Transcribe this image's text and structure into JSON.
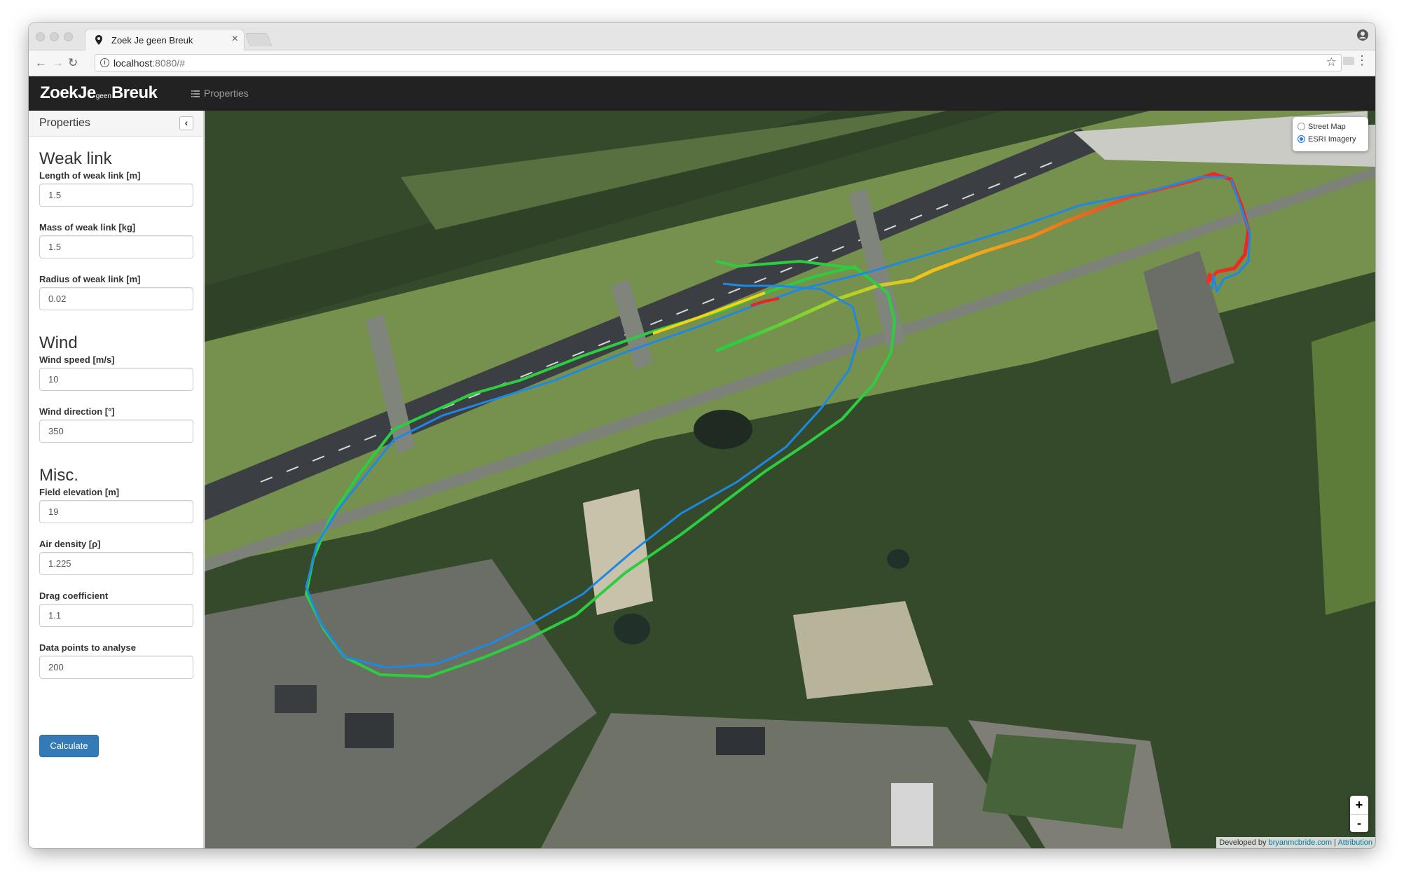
{
  "browser": {
    "tab_title": "Zoek Je geen Breuk",
    "url_host": "localhost",
    "url_rest": ":8080/#"
  },
  "app": {
    "brand_main1": "ZoekJe",
    "brand_small": "geen",
    "brand_main2": "Breuk",
    "nav_properties": "Properties"
  },
  "sidebar": {
    "title": "Properties",
    "weak_link": {
      "heading": "Weak link",
      "length_label": "Length of weak link [m]",
      "length_value": "1.5",
      "mass_label": "Mass of weak link [kg]",
      "mass_value": "1.5",
      "radius_label": "Radius of weak link [m]",
      "radius_value": "0.02"
    },
    "wind": {
      "heading": "Wind",
      "speed_label": "Wind speed [m/s]",
      "speed_value": "10",
      "direction_label": "Wind direction [°]",
      "direction_value": "350"
    },
    "misc": {
      "heading": "Misc.",
      "elevation_label": "Field elevation [m]",
      "elevation_value": "19",
      "density_label": "Air density [ρ]",
      "density_value": "1.225",
      "drag_label": "Drag coefficient",
      "drag_value": "1.1",
      "points_label": "Data points to analyse",
      "points_value": "200"
    },
    "calculate_label": "Calculate"
  },
  "map": {
    "layers": {
      "street_map": "Street Map",
      "esri_imagery": "ESRI Imagery",
      "selected": "ESRI Imagery"
    },
    "zoom_in": "+",
    "zoom_out": "-",
    "attribution_prefix": "Developed by",
    "attribution_link": "bryanmcbride.com",
    "attribution_sep": "|",
    "attribution_label": "Attribution"
  },
  "colors": {
    "accent_button": "#337ab7",
    "appbar": "#222222",
    "track_blue": "#1e88e5",
    "track_green": "#2ecc40",
    "track_red": "#ee2222"
  }
}
